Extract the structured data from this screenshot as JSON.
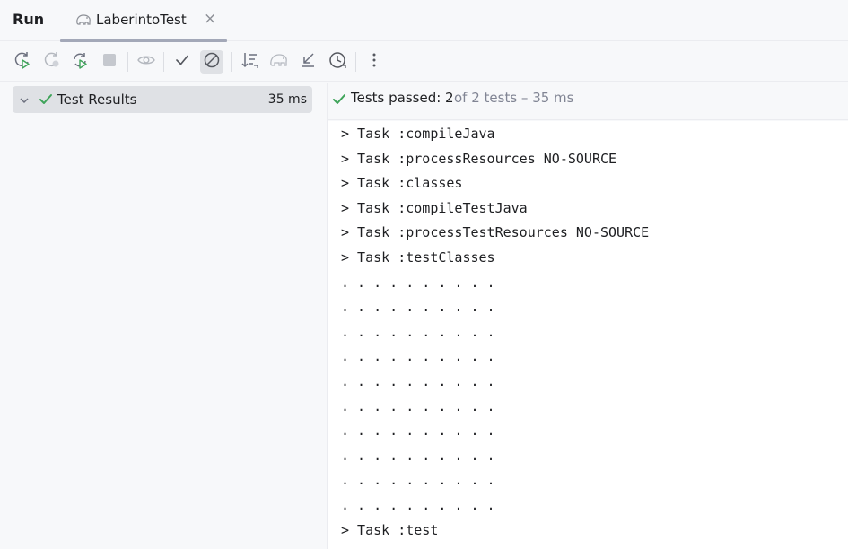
{
  "header": {
    "title": "Run",
    "tab": {
      "label": "LaberintoTest",
      "icon": "gradle-elephant-icon",
      "close_glyph": "×"
    }
  },
  "toolbar": {
    "buttons": [
      {
        "name": "rerun-button",
        "icon": "rerun-icon"
      },
      {
        "name": "rerun-failed-button",
        "icon": "rerun-failed-icon"
      },
      {
        "name": "toggle-auto-test-button",
        "icon": "auto-rerun-icon"
      },
      {
        "name": "stop-button",
        "icon": "stop-icon"
      },
      {
        "name": "show-passed-button",
        "icon": "eye-icon"
      },
      {
        "name": "show-passed-tests-button",
        "icon": "check-icon"
      },
      {
        "name": "show-ignored-button",
        "icon": "ignored-icon"
      },
      {
        "name": "sort-button",
        "icon": "sort-icon"
      },
      {
        "name": "gradle-button",
        "icon": "gradle-icon"
      },
      {
        "name": "import-tests-button",
        "icon": "import-icon"
      },
      {
        "name": "history-button",
        "icon": "clock-icon"
      },
      {
        "name": "more-button",
        "icon": "more-vertical-icon"
      }
    ]
  },
  "tree": {
    "root_label": "Test Results",
    "root_time": "35 ms"
  },
  "status": {
    "strong": "Tests passed: 2",
    "rest": " of 2 tests – 35 ms"
  },
  "console": {
    "lines": [
      "> Task :compileJava",
      "> Task :processResources NO-SOURCE",
      "> Task :classes",
      "> Task :compileTestJava",
      "> Task :processTestResources NO-SOURCE",
      "> Task :testClasses",
      ". . . . . . . . . .",
      ". . . . . . . . . .",
      ". . . . . . . . . .",
      ". . . . . . . . . .",
      ". . . . . . . . . .",
      ". . . . . . . . . .",
      ". . . . . . . . . .",
      ". . . . . . . . . .",
      ". . . . . . . . . .",
      ". . . . . . . . . .",
      "> Task :test"
    ]
  },
  "colors": {
    "success": "#3fa45a",
    "icon": "#6c707e",
    "icon_disabled": "#b4b8bf"
  }
}
